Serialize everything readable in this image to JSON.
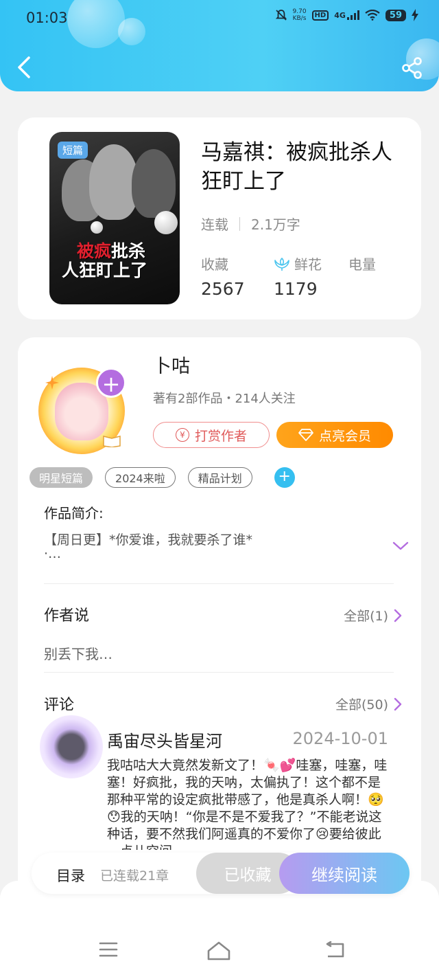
{
  "status_bar": {
    "time": "01:03",
    "net_speed_value": "9.70",
    "net_speed_unit": "KB/s",
    "hd": "HD",
    "network": "4G",
    "battery": "59"
  },
  "book": {
    "cover_tag": "短篇",
    "cover_title_line1_red": "被疯",
    "cover_title_line1_white": "批杀",
    "cover_title_line2": "人狂盯上了",
    "title": "马嘉祺：被疯批杀人狂盯上了",
    "status": "连载",
    "word_count": "2.1万字",
    "stats": {
      "favorites_label": "收藏",
      "favorites_value": "2567",
      "flowers_label": "鲜花",
      "flowers_value": "1179",
      "power_label": "电量"
    }
  },
  "author": {
    "name": "卜咕",
    "info": "著有2部作品・214人关注",
    "tip_label": "打赏作者",
    "tip_icon": "¥",
    "vip_label": "点亮会员"
  },
  "tags": [
    "明星短篇",
    "2024来啦",
    "精品计划"
  ],
  "intro": {
    "title": "作品简介:",
    "text_line1": "【周日更】*你爱谁，我就要杀了谁*",
    "text_line2": "·…"
  },
  "author_says": {
    "title": "作者说",
    "more": "全部(1)",
    "text": "别丢下我…"
  },
  "comments": {
    "title": "评论",
    "more": "全部(50)",
    "first": {
      "name": "禹宙尽头皆星河",
      "date": "2024-10-01",
      "text": "我咕咕大大竟然发新文了！🍬💕哇塞，哇塞，哇塞！好疯批，我的天呐，太偏执了！这个都不是那种平常的设定疯批带感了，他是真杀人啊！🥺😯我的天呐！“你是不是不爱我了？”不能老说这种话，要不然我们阿遥真的不爱你了😢要给彼此一点儿空间"
    }
  },
  "bottom_bar": {
    "toc": "目录",
    "serial": "已连载21章",
    "collected": "已收藏",
    "continue": "继续阅读"
  },
  "colors": {
    "header": "#34c3f4",
    "vip_orange": "#ff8a00",
    "accent_purple": "#b46de0",
    "tip_red": "#e05a5a"
  }
}
